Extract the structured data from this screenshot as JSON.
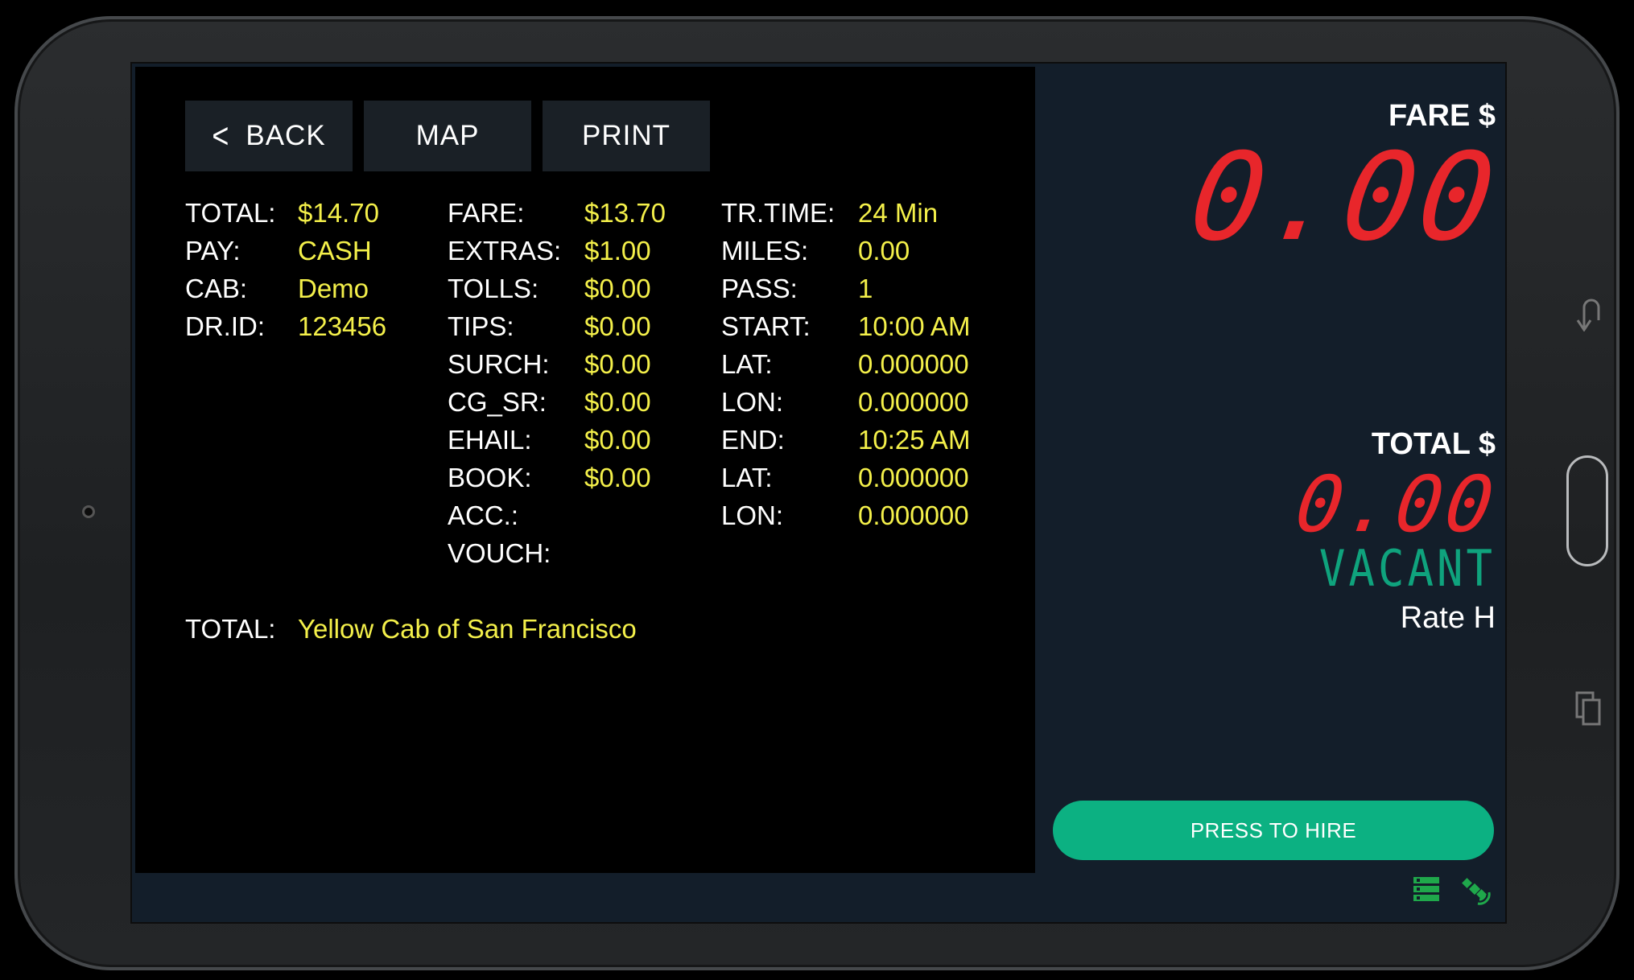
{
  "toolbar": {
    "back_label": "BACK",
    "map_label": "MAP",
    "print_label": "PRINT"
  },
  "trip": {
    "col1": [
      {
        "label": "TOTAL:",
        "value": "$14.70"
      },
      {
        "label": "PAY:",
        "value": "CASH"
      },
      {
        "label": "CAB:",
        "value": "Demo"
      },
      {
        "label": "DR.ID:",
        "value": "123456"
      }
    ],
    "col2": [
      {
        "label": "FARE:",
        "value": "$13.70"
      },
      {
        "label": "EXTRAS:",
        "value": "$1.00"
      },
      {
        "label": "TOLLS:",
        "value": "$0.00"
      },
      {
        "label": "TIPS:",
        "value": "$0.00"
      },
      {
        "label": "SURCH:",
        "value": "$0.00"
      },
      {
        "label": "CG_SR:",
        "value": "$0.00"
      },
      {
        "label": "EHAIL:",
        "value": "$0.00"
      },
      {
        "label": "BOOK:",
        "value": "$0.00"
      },
      {
        "label": "ACC.:",
        "value": ""
      },
      {
        "label": "VOUCH:",
        "value": ""
      }
    ],
    "col3": [
      {
        "label": "TR.TIME:",
        "value": "24 Min"
      },
      {
        "label": "MILES:",
        "value": "0.00"
      },
      {
        "label": "PASS:",
        "value": "1"
      },
      {
        "label": "START:",
        "value": "10:00 AM"
      },
      {
        "label": "LAT:",
        "value": "0.000000"
      },
      {
        "label": "LON:",
        "value": "0.000000"
      },
      {
        "label": "END:",
        "value": "10:25 AM"
      },
      {
        "label": "LAT:",
        "value": "0.000000"
      },
      {
        "label": "LON:",
        "value": "0.000000"
      }
    ],
    "company_label": "TOTAL:",
    "company_value": "Yellow Cab of San Francisco"
  },
  "meter": {
    "fare_label": "FARE $",
    "fare_value": "0.00",
    "total_label": "TOTAL $",
    "total_value": "0.00",
    "status": "VACANT",
    "rate": "Rate H",
    "hire_button": "PRESS TO HIRE"
  },
  "icons": {
    "status": [
      "server-icon",
      "satellite-icon"
    ],
    "hardware": [
      "back-icon",
      "home-button",
      "recent-apps-icon"
    ]
  },
  "colors": {
    "value_yellow": "#f4f04a",
    "meter_red": "#e8262b",
    "vacant_green": "#0fa37d",
    "hire_green": "#0cb182",
    "pane_navy": "#131e2a"
  }
}
